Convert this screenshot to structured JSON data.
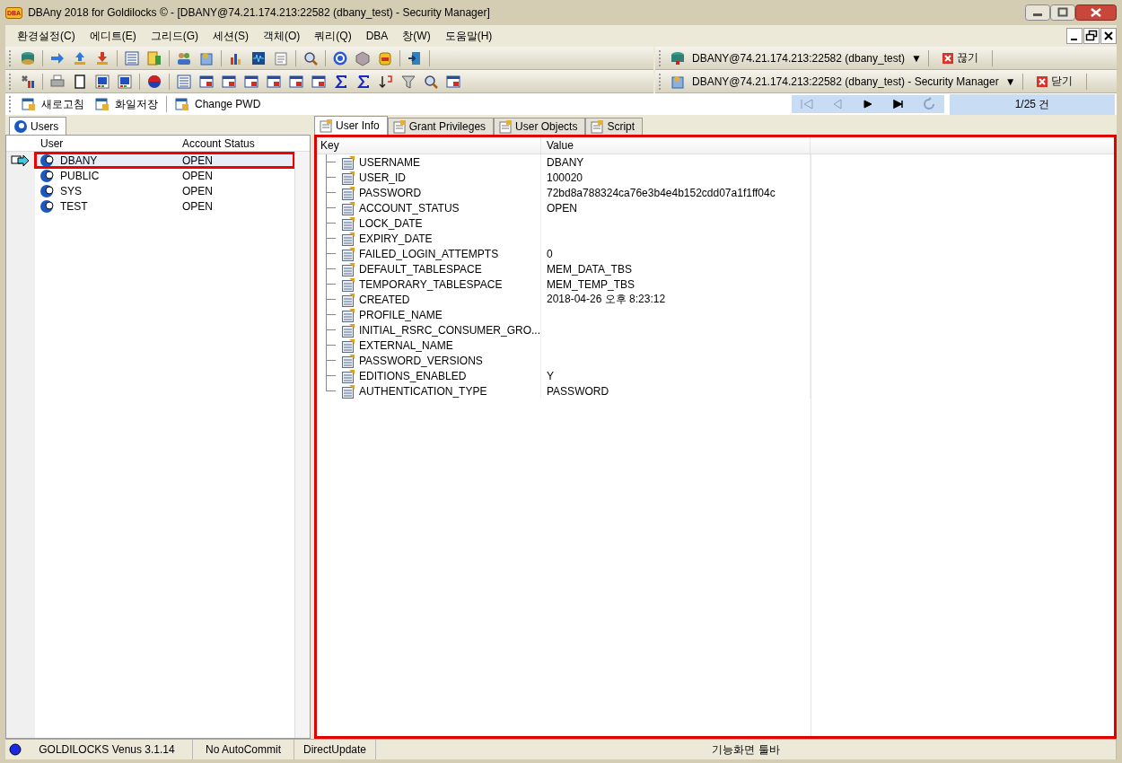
{
  "window": {
    "title": "DBAny 2018 for Goldilocks © - [DBANY@74.21.174.213:22582 (dbany_test) - Security Manager]",
    "app_badge": "DBA"
  },
  "menu": [
    "환경설정(C)",
    "에디트(E)",
    "그리드(G)",
    "세션(S)",
    "객체(O)",
    "쿼리(Q)",
    "DBA",
    "창(W)",
    "도움말(H)"
  ],
  "connection_bar": {
    "label": "DBANY@74.21.174.213:22582 (dbany_test)",
    "dropdown": "▼",
    "action": "끊기"
  },
  "window_bar": {
    "label": "DBANY@74.21.174.213:22582 (dbany_test) - Security Manager",
    "dropdown": "▼",
    "action": "닫기"
  },
  "actions": [
    "새로고침",
    "화일저장",
    "Change PWD"
  ],
  "navigation": [
    {
      "kind": "first",
      "disabled": true
    },
    {
      "kind": "prev",
      "disabled": true
    },
    {
      "kind": "next",
      "disabled": false
    },
    {
      "kind": "last",
      "disabled": false
    },
    {
      "kind": "refresh",
      "disabled": true
    }
  ],
  "record_counter": "1/25 건",
  "users_panel": {
    "tab": "Users",
    "columns": [
      "User",
      "Account Status"
    ],
    "rows": [
      {
        "user": "DBANY",
        "status": "OPEN",
        "selected": true
      },
      {
        "user": "PUBLIC",
        "status": "OPEN",
        "selected": false
      },
      {
        "user": "SYS",
        "status": "OPEN",
        "selected": false
      },
      {
        "user": "TEST",
        "status": "OPEN",
        "selected": false
      }
    ]
  },
  "detail_tabs": [
    {
      "label": "User Info",
      "selected": true
    },
    {
      "label": "Grant Privileges",
      "selected": false
    },
    {
      "label": "User Objects",
      "selected": false
    },
    {
      "label": "Script",
      "selected": false
    }
  ],
  "info_table": {
    "columns": [
      "Key",
      "Value"
    ],
    "rows": [
      {
        "key": "USERNAME",
        "value": "DBANY"
      },
      {
        "key": "USER_ID",
        "value": "100020"
      },
      {
        "key": "PASSWORD",
        "value": "72bd8a788324ca76e3b4e4b152cdd07a1f1ff04c"
      },
      {
        "key": "ACCOUNT_STATUS",
        "value": "OPEN"
      },
      {
        "key": "LOCK_DATE"
      },
      {
        "key": "EXPIRY_DATE"
      },
      {
        "key": "FAILED_LOGIN_ATTEMPTS",
        "value": "0"
      },
      {
        "key": "DEFAULT_TABLESPACE",
        "value": "MEM_DATA_TBS"
      },
      {
        "key": "TEMPORARY_TABLESPACE",
        "value": "MEM_TEMP_TBS"
      },
      {
        "key": "CREATED",
        "value": "2018-04-26 오후 8:23:12"
      },
      {
        "key": "PROFILE_NAME"
      },
      {
        "key": "INITIAL_RSRC_CONSUMER_GRO..."
      },
      {
        "key": "EXTERNAL_NAME"
      },
      {
        "key": "PASSWORD_VERSIONS"
      },
      {
        "key": "EDITIONS_ENABLED",
        "value": "Y"
      },
      {
        "key": "AUTHENTICATION_TYPE",
        "value": "PASSWORD"
      }
    ]
  },
  "status_bar": [
    "GOLDILOCKS Venus 3.1.14",
    "No AutoCommit",
    "DirectUpdate",
    "기능화면 툴바"
  ]
}
